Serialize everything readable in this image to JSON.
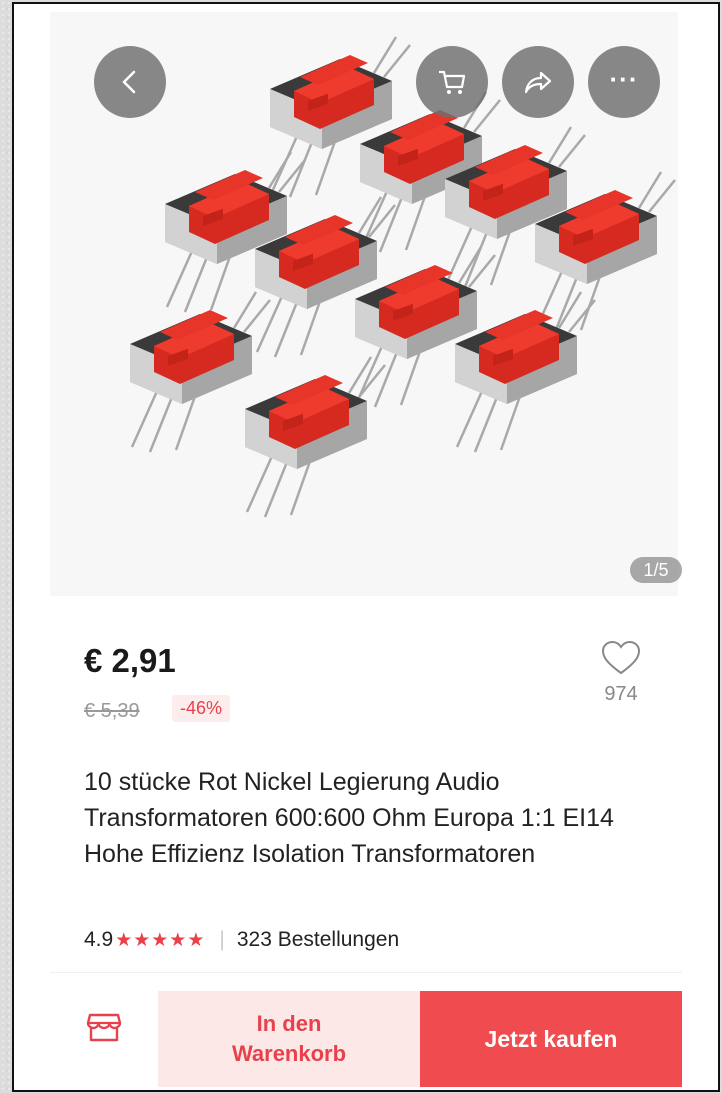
{
  "gallery": {
    "image_alt": "10 rote Audio-Transformatoren",
    "counter": "1/5"
  },
  "header": {
    "back_icon": "chevron-left-icon",
    "cart_icon": "cart-icon",
    "share_icon": "share-icon",
    "more_icon": "more-dots-icon",
    "more_label": "···"
  },
  "product": {
    "price": "€ 2,91",
    "original_price": "€ 5,39",
    "discount": "-46%",
    "favorites": "974",
    "title": "10 stücke Rot Nickel Legierung Audio Transformatoren 600:600 Ohm Europa 1:1 EI14 Hohe Effizienz Isolation Transformatoren",
    "rating": "4.9",
    "stars": "★★★★★",
    "orders": "323 Bestellungen"
  },
  "actions": {
    "store_icon": "store-icon",
    "add_to_cart_line1": "In den",
    "add_to_cart_line2": "Warenkorb",
    "buy_now": "Jetzt kaufen"
  },
  "colors": {
    "accent": "#f04b4f",
    "accent_light": "#fde8e8",
    "transformer_red": "#e32b22"
  }
}
